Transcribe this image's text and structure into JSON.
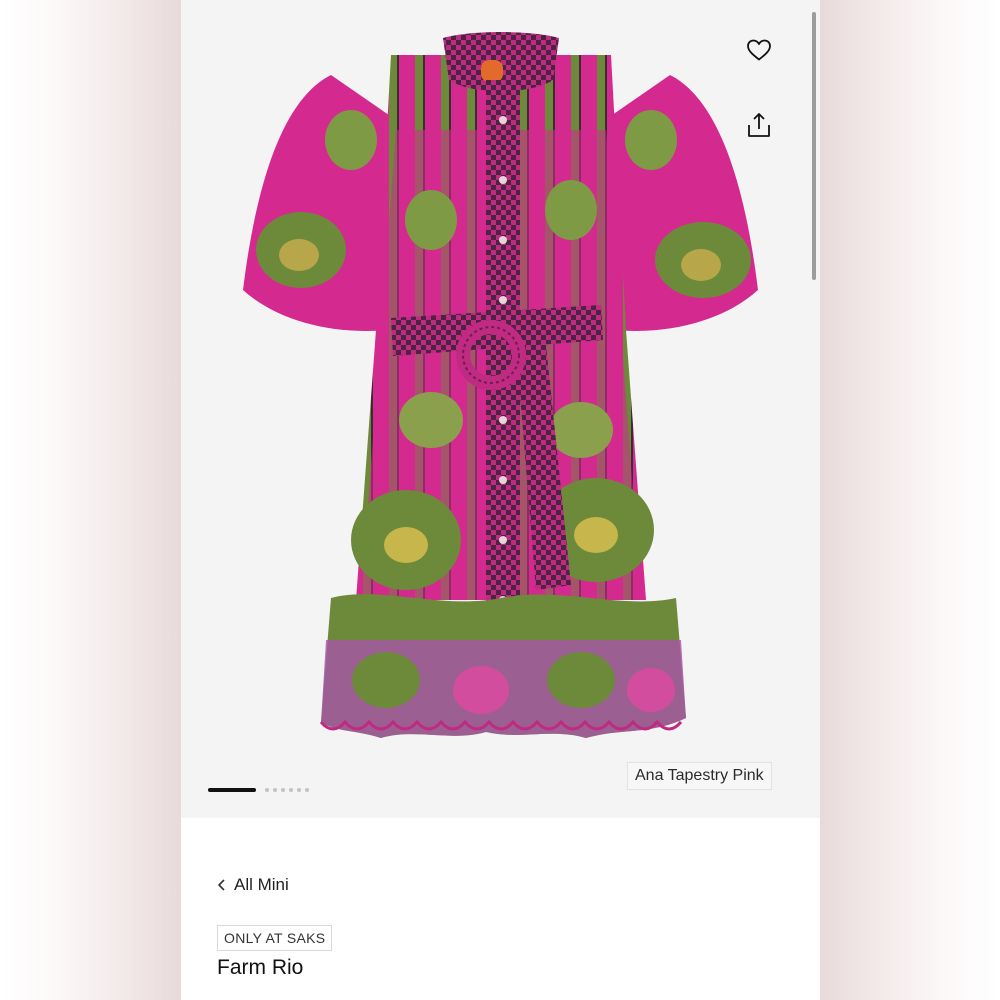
{
  "product": {
    "color_name": "Ana Tapestry Pink",
    "brand": "Farm Rio",
    "badge": "ONLY AT SAKS"
  },
  "navigation": {
    "back_label": "All Mini"
  },
  "gallery": {
    "image_count": 8,
    "active_index": 0
  },
  "icons": {
    "wishlist": "heart-icon",
    "share": "share-icon",
    "back": "chevron-left-icon"
  },
  "colors": {
    "dress_pink": "#d42a8f",
    "leaf_green": "#6c8a3a",
    "trim_dark": "#4a2440",
    "background": "#f4f4f4"
  }
}
